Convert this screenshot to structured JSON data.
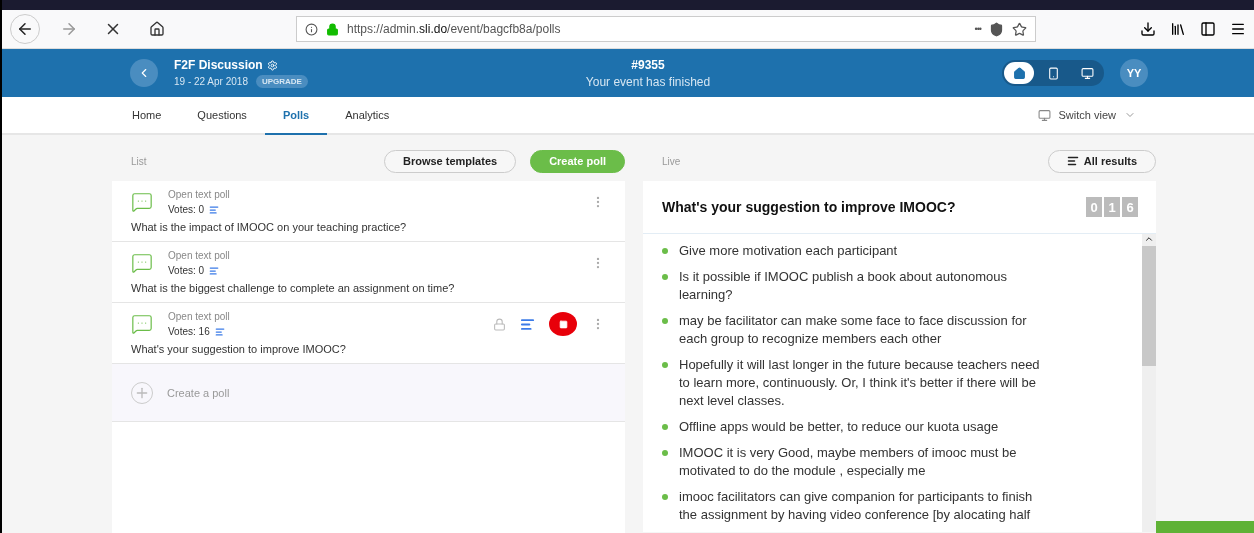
{
  "browser": {
    "url_prefix": "https://admin.",
    "url_domain": "sli.do",
    "url_path": "/event/bagcfb8a/polls",
    "menu_dots": "•••"
  },
  "header": {
    "event_name": "F2F Discussion",
    "dates": "19 - 22 Apr 2018",
    "badge": "UPGRADE",
    "code": "#9355",
    "status": "Your event has finished",
    "views": [
      {
        "kind": "home",
        "selected": true
      },
      {
        "kind": "mobile",
        "selected": false
      },
      {
        "kind": "screen",
        "selected": false
      }
    ],
    "avatar": "YY"
  },
  "tabs": [
    {
      "label": "Home",
      "selected": false
    },
    {
      "label": "Questions",
      "selected": false
    },
    {
      "label": "Polls",
      "selected": true
    },
    {
      "label": "Analytics",
      "selected": false
    }
  ],
  "switch_view": "Switch view",
  "list": {
    "title": "List",
    "browse": "Browse templates",
    "create": "Create poll",
    "create_row": "Create a poll",
    "polls": [
      {
        "type": "Open text poll",
        "votes": "Votes: 0",
        "question": "What is the impact of IMOOC on your teaching practice?",
        "active": false
      },
      {
        "type": "Open text poll",
        "votes": "Votes: 0",
        "question": "What is the biggest challenge to complete an assignment on time?",
        "active": false
      },
      {
        "type": "Open text poll",
        "votes": "Votes: 16",
        "question": "What's your suggestion to improve IMOOC?",
        "active": true
      }
    ]
  },
  "live": {
    "title": "Live",
    "all_results": "All results",
    "question": "What's your suggestion to improve IMOOC?",
    "digits": [
      "0",
      "1",
      "6"
    ],
    "answers": [
      "Give more motivation each participant",
      "Is it possible if IMOOC publish a book about autonomous learning?",
      "may be facilitator can make some face to face discussion for each group to recognize members each other",
      "Hopefully it will last longer in the future because teachers need to learn more, continuously. Or, I think it's better if there will be next level classes.",
      "Offline apps would be better, to reduce our kuota usage",
      "IMOOC it is very Good, maybe members of imooc must be motivated to do the module , especially me",
      "imooc facilitators can give companion for participants to finish the assignment by having video conference [by alocating half"
    ]
  }
}
